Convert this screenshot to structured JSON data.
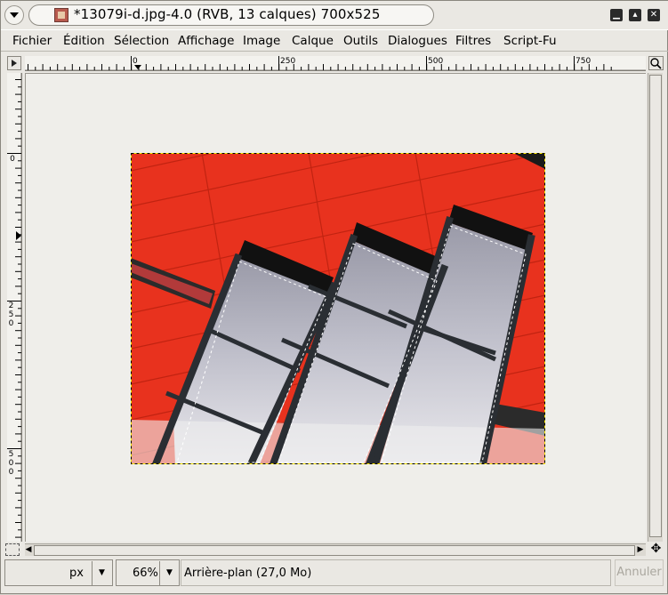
{
  "window": {
    "title": "*13079i-d.jpg-4.0 (RVB, 13 calques) 700x525",
    "controls": {
      "minimize": "▁",
      "maximize": "▴",
      "close": "✕"
    }
  },
  "menu": [
    "Fichier",
    "Édition",
    "Sélection",
    "Affichage",
    "Image",
    "Calque",
    "Outils",
    "Dialogues",
    "Filtres",
    "Script-Fu"
  ],
  "rulers": {
    "horizontal_labels": [
      "0",
      "250",
      "500",
      "750"
    ],
    "vertical_labels": [
      "0",
      "250",
      "500"
    ]
  },
  "statusbar": {
    "coords": "",
    "unit": "px",
    "zoom": "66%",
    "layer_info": "Arrière-plan (27,0 Mo)",
    "cancel_label": "Annuler"
  },
  "colors": {
    "facade_red": "#e8321e",
    "frame_dark": "#2a2e33",
    "glass": "#c9c9d2"
  }
}
